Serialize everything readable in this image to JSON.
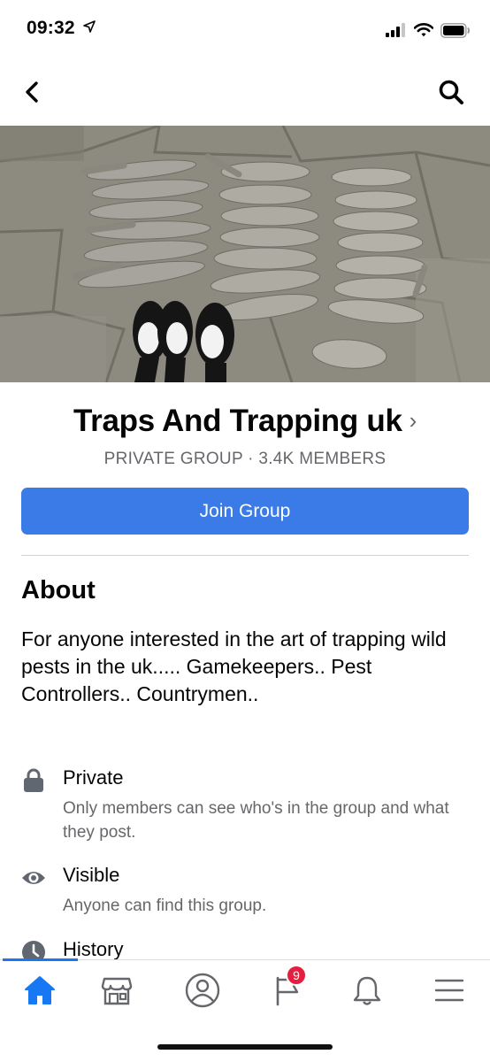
{
  "status": {
    "time": "09:32",
    "icons": [
      "location-arrow-icon",
      "cellular-signal-icon",
      "wifi-icon",
      "battery-icon"
    ]
  },
  "header": {
    "back_icon": "chevron-left-icon",
    "search_icon": "search-icon"
  },
  "cover": {
    "description_icon": "cover-photo"
  },
  "group": {
    "name": "Traps And Trapping uk",
    "chevron": "›",
    "meta": "PRIVATE GROUP · 3.4K MEMBERS",
    "join_label": "Join Group"
  },
  "about": {
    "title": "About",
    "description": "For anyone interested in the art of trapping wild pests in the uk..... Gamekeepers.. Pest Controllers.. Countrymen..",
    "items": [
      {
        "icon": "lock-icon",
        "title": "Private",
        "subtitle": "Only members can see who's in the group and what they post."
      },
      {
        "icon": "eye-icon",
        "title": "Visible",
        "subtitle": "Anyone can find this group."
      },
      {
        "icon": "clock-icon",
        "title": "History",
        "subtitle": ""
      }
    ]
  },
  "tabs": [
    {
      "icon": "home-icon",
      "active": true
    },
    {
      "icon": "marketplace-icon",
      "active": false
    },
    {
      "icon": "profile-icon",
      "active": false
    },
    {
      "icon": "pages-flag-icon",
      "active": false,
      "badge": "9"
    },
    {
      "icon": "bell-icon",
      "active": false
    },
    {
      "icon": "menu-icon",
      "active": false
    }
  ],
  "colors": {
    "accent": "#1877f2",
    "join_button": "#3b7be8",
    "secondary_text": "#65676b",
    "badge": "#e41e3f"
  }
}
